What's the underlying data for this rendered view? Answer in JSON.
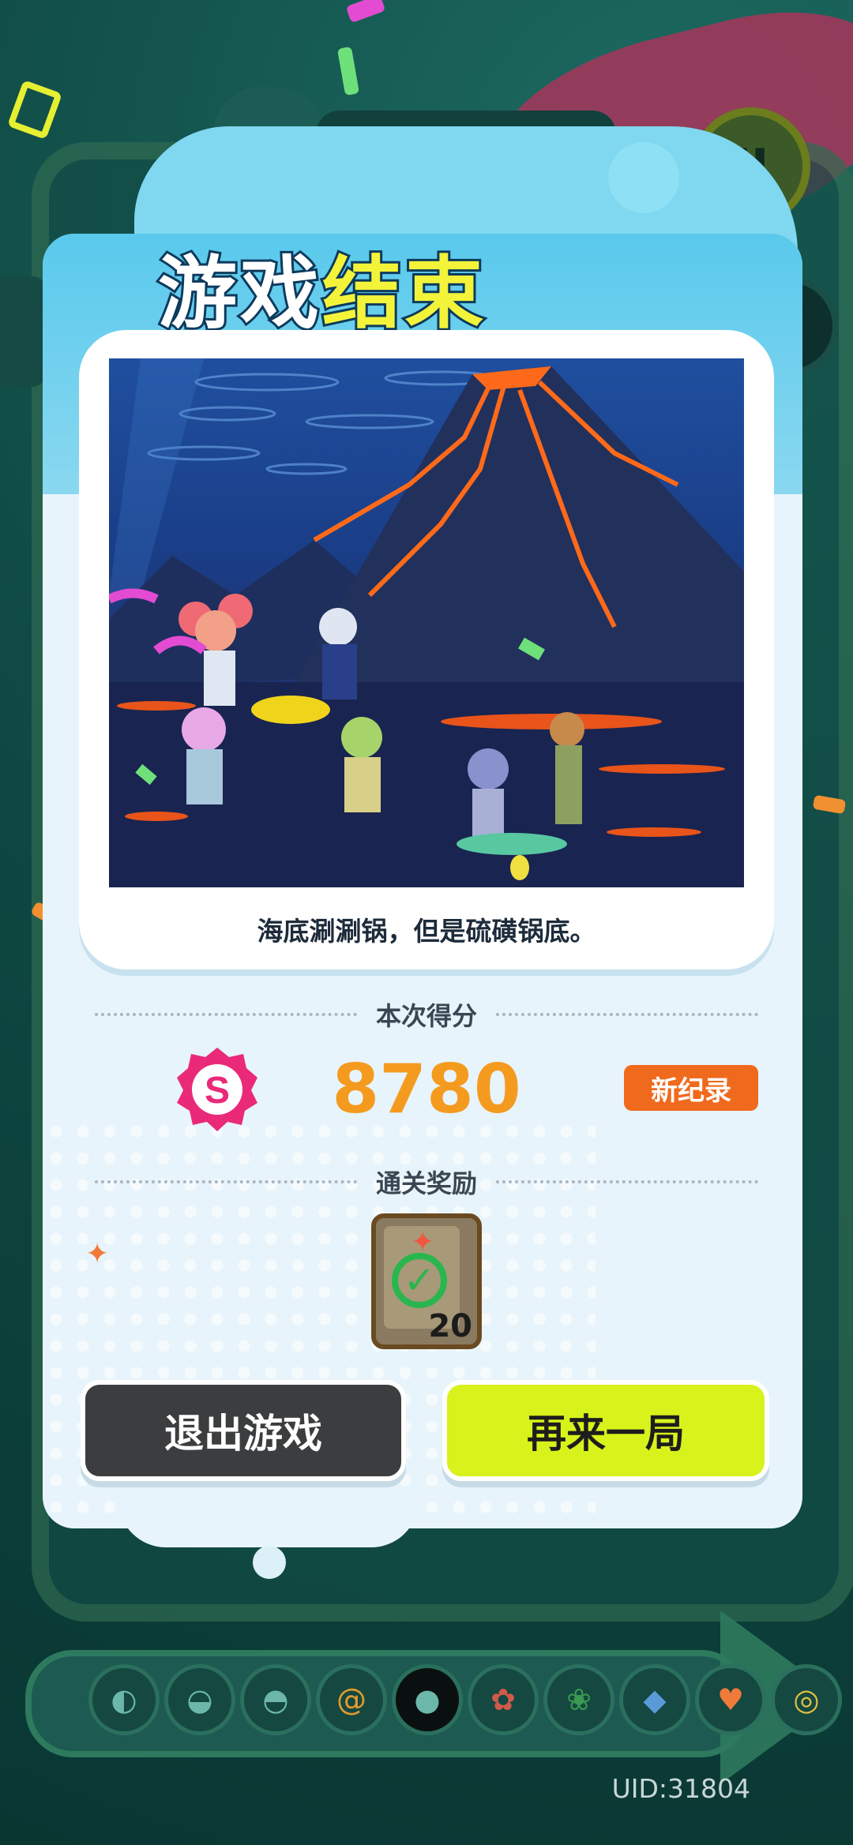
{
  "background": {
    "score": "8780",
    "pause_icon": "pause-icon",
    "tray_slots": [
      "shell",
      "shell",
      "clam",
      "ammonite",
      "pearl",
      "coral",
      "coral-green",
      "crystal",
      "heart-gem",
      "coin"
    ],
    "uid": "UID:31804"
  },
  "modal": {
    "title_part1": "游戏",
    "title_part2": "结束",
    "caption": "海底涮涮锅，但是硫磺锅底。",
    "score_section_label": "本次得分",
    "score_badge_letter": "S",
    "score": "8780",
    "new_record_label": "新纪录",
    "reward_section_label": "通关奖励",
    "reward_count": "20",
    "exit_button": "退出游戏",
    "again_button": "再来一局"
  },
  "colors": {
    "accent_yellow": "#d8f21b",
    "score_orange": "#f49b1f",
    "record_badge": "#f06a1d",
    "exit_button": "#3b3d3f",
    "badge_pink": "#ea2a78"
  }
}
